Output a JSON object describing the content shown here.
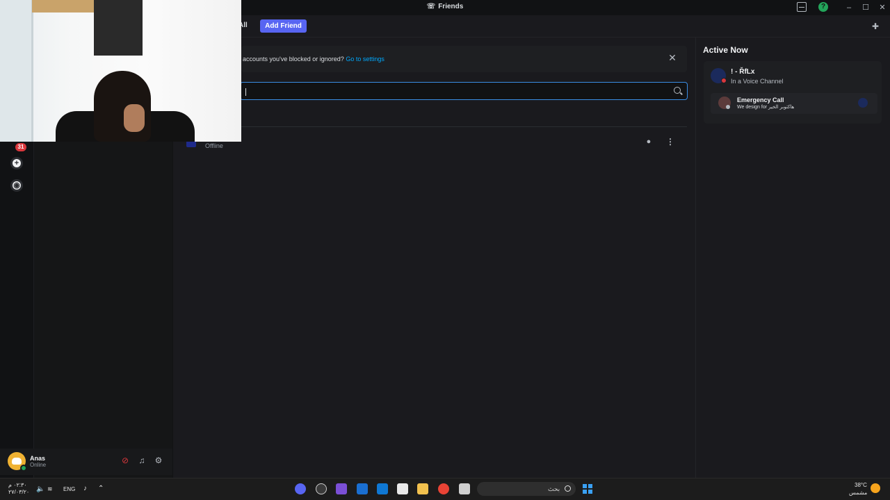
{
  "window": {
    "title": "Friends"
  },
  "top_nav": {
    "tab_all_label": "All",
    "add_friend_label": "Add Friend"
  },
  "notice": {
    "text": "accounts you've blocked or ignored?",
    "link": "Go to settings"
  },
  "search": {
    "value": "",
    "placeholder": ""
  },
  "friend_list": [
    {
      "status": "Offline"
    }
  ],
  "server_rail": {
    "badge_count": "31"
  },
  "user_panel": {
    "username": "Anas",
    "status": "Online"
  },
  "active_now": {
    "title": "Active Now",
    "card": {
      "name": "! - ŘfLx",
      "subtitle": "In a Voice Channel",
      "channel_name": "Emergency Call",
      "server_name": "We design for هاكتوبر الخير"
    }
  },
  "taskbar": {
    "time": "٠٢:٣٠ م",
    "date": "٢٧/٠٣/٢٠",
    "language": "ENG",
    "search_label": "بحث",
    "weather_temp": "38°C",
    "weather_desc": "مشمس"
  },
  "colors": {
    "accent": "#5865f2",
    "link": "#00a8fc",
    "online": "#23a55a",
    "dnd": "#da373c",
    "background": "#1a1a1e"
  }
}
